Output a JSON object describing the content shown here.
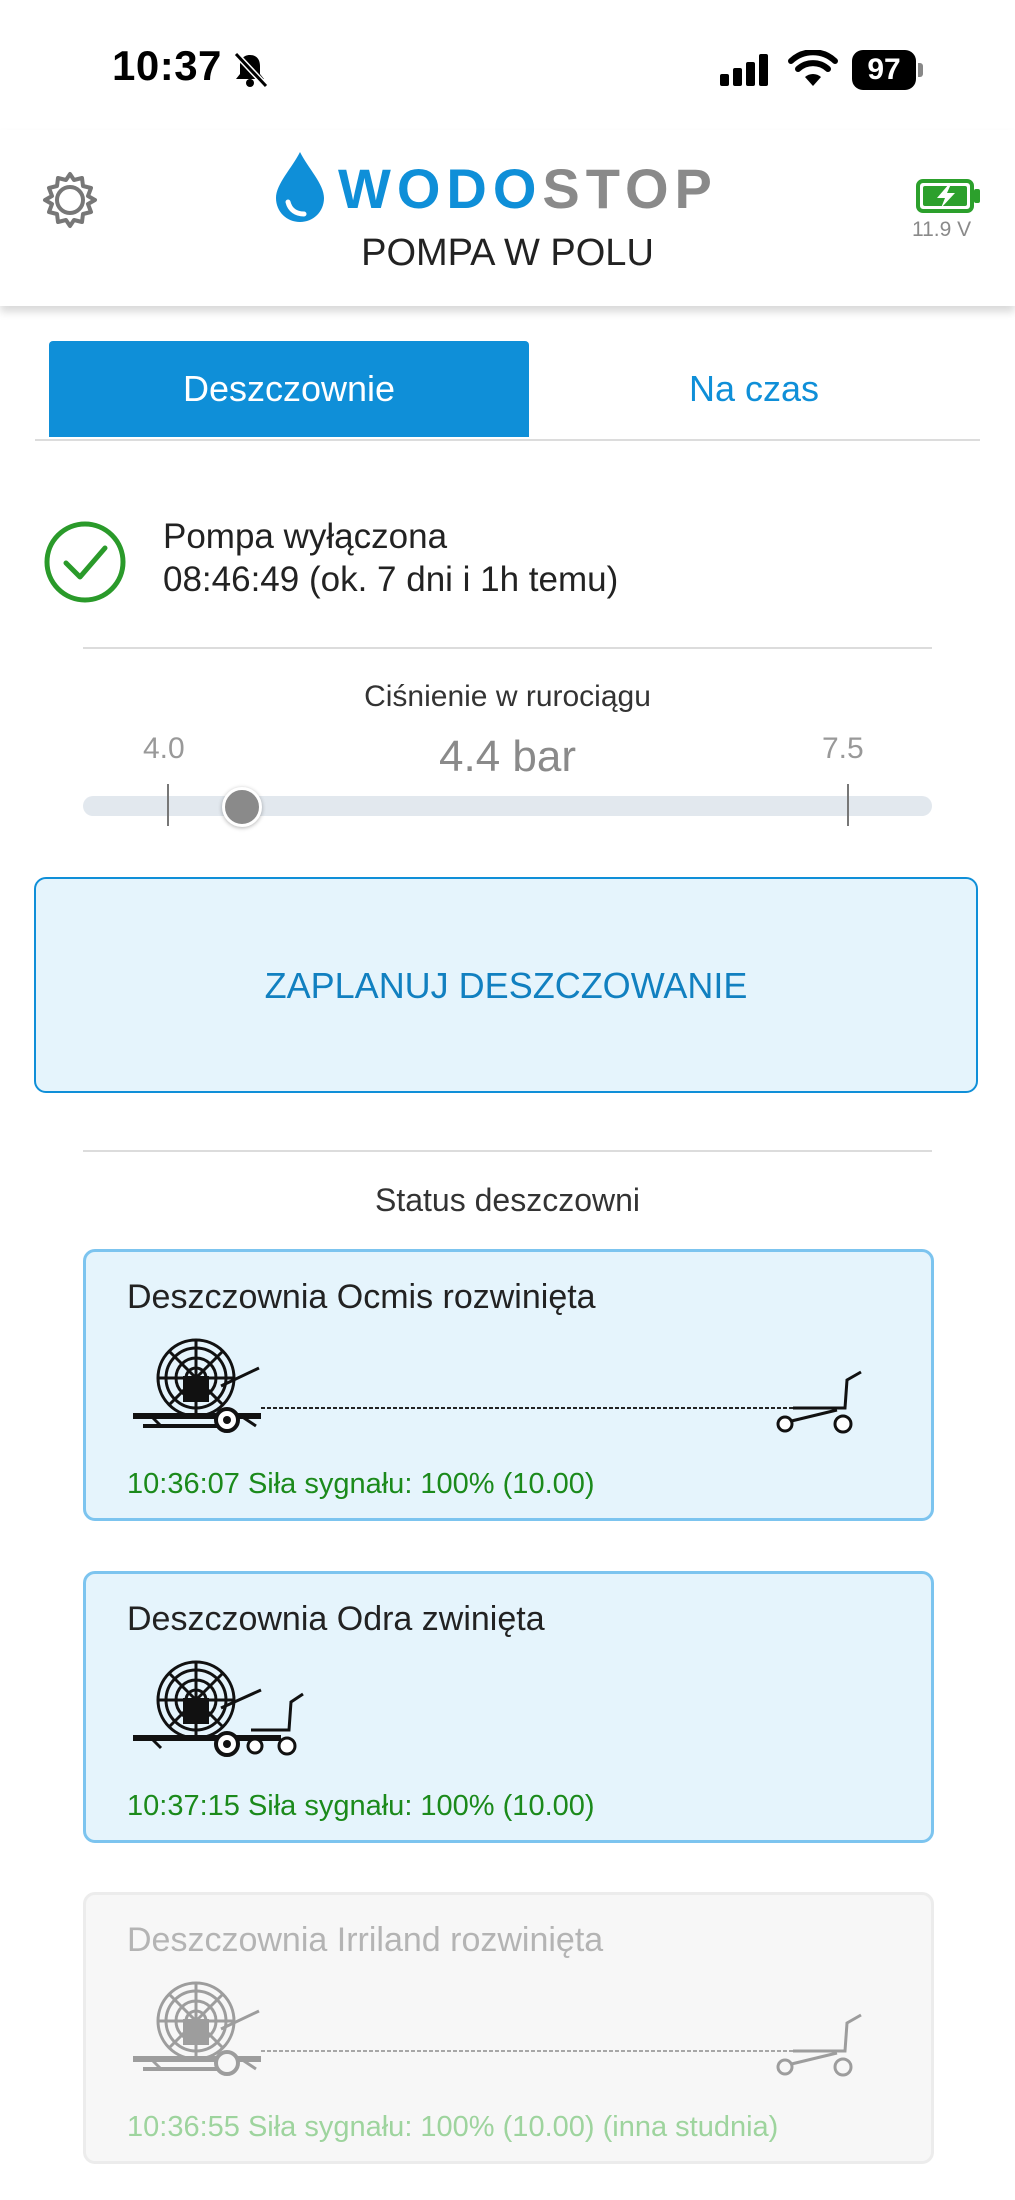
{
  "status_bar": {
    "time": "10:37",
    "battery": "97"
  },
  "header": {
    "logo_part1": "WODO",
    "logo_part2": "STOP",
    "title": "POMPA W POLU",
    "voltage": "11.9 V",
    "brand_color": "#0f8fd8",
    "battery_color": "#2ca02c"
  },
  "tabs": [
    {
      "label": "Deszczownie",
      "active": true
    },
    {
      "label": "Na czas",
      "active": false
    }
  ],
  "pump": {
    "state": "Pompa wyłączona",
    "time_info": "08:46:49 (ok. 7 dni i 1h temu)",
    "icon": "check-circle-icon"
  },
  "pressure": {
    "label": "Ciśnienie w rurociągu",
    "min_label": "4.0",
    "value_label": "4.4 bar",
    "max_label": "7.5"
  },
  "plan_button": {
    "label": "ZAPLANUJ DESZCZOWANIE"
  },
  "reels_section": {
    "title": "Status deszczowni",
    "items": [
      {
        "title": "Deszczownia Ocmis rozwinięta",
        "signal": "10:36:07 Siła sygnału: 100% (10.00)",
        "extended": true,
        "active": true
      },
      {
        "title": "Deszczownia Odra zwinięta",
        "signal": "10:37:15 Siła sygnału: 100% (10.00)",
        "extended": false,
        "active": true
      },
      {
        "title": "Deszczownia Irriland rozwinięta",
        "signal": "10:36:55 Siła sygnału: 100% (10.00) (inna studnia)",
        "extended": true,
        "active": false
      }
    ]
  }
}
